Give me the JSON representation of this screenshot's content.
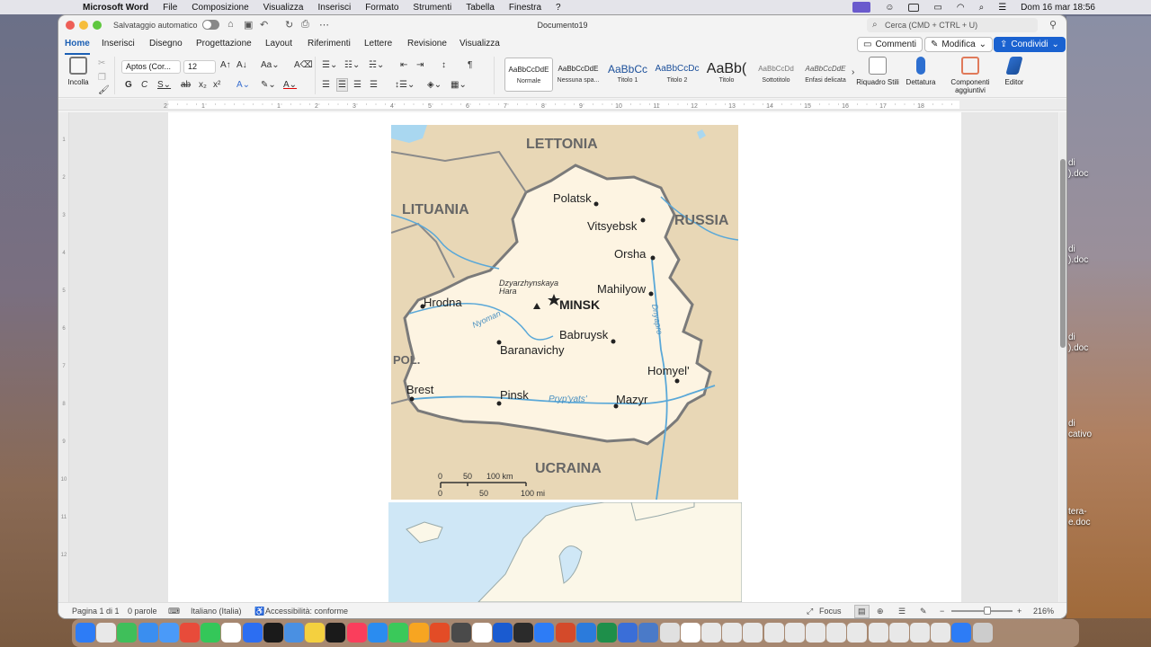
{
  "menubar": {
    "app": "Microsoft Word",
    "items": [
      "File",
      "Composizione",
      "Visualizza",
      "Inserisci",
      "Formato",
      "Strumenti",
      "Tabella",
      "Finestra",
      "?"
    ],
    "datetime": "Dom 16 mar  18:56"
  },
  "desktop_files": [
    "di\n).doc",
    "di\n).doc",
    "di\n).doc",
    "di\ncativo",
    "tera-\ne.doc"
  ],
  "window": {
    "autosave_label": "Salvataggio automatico",
    "doc_title": "Documento19",
    "search_placeholder": "Cerca (CMD + CTRL + U)"
  },
  "tabs": [
    "Home",
    "Inserisci",
    "Disegno",
    "Progettazione",
    "Layout",
    "Riferimenti",
    "Lettere",
    "Revisione",
    "Visualizza"
  ],
  "actions": {
    "comments": "Commenti",
    "edit": "Modifica",
    "share": "Condividi"
  },
  "ribbon": {
    "paste": "Incolla",
    "font": "Aptos (Cor...",
    "size": "12",
    "styles": [
      {
        "preview": "AaBbCcDdE",
        "label": "Normale"
      },
      {
        "preview": "AaBbCcDdE",
        "label": "Nessuna spa..."
      },
      {
        "preview": "AaBbCc",
        "label": "Titolo 1"
      },
      {
        "preview": "AaBbCcDc",
        "label": "Titolo 2"
      },
      {
        "preview": "AaBb(",
        "label": "Titolo"
      },
      {
        "preview": "AaBbCcDd",
        "label": "Sottotitolo"
      },
      {
        "preview": "AaBbCcDdE",
        "label": "Enfasi delicata"
      }
    ],
    "pane": "Riquadro Stili",
    "dictate": "Dettatura",
    "addins": "Componenti aggiuntivi",
    "editor": "Editor"
  },
  "ruler_numbers": [
    "2",
    "1",
    "1",
    "2",
    "3",
    "4",
    "5",
    "6",
    "7",
    "8",
    "9",
    "10",
    "11",
    "12",
    "13",
    "14",
    "15",
    "16",
    "17",
    "18"
  ],
  "vruler_numbers": [
    "1",
    "2",
    "3",
    "4",
    "5",
    "6",
    "7",
    "8",
    "9",
    "10",
    "11",
    "12"
  ],
  "map": {
    "countries": [
      "LETTONIA",
      "LITUANIA",
      "RUSSIA",
      "POL.",
      "UCRAINA"
    ],
    "cities": [
      "Polatsk",
      "Vitsyebsk",
      "Orsha",
      "Mahilyow",
      "Hrodna",
      "Babruysk",
      "Baranavichy",
      "Homyel'",
      "Brest",
      "Pinsk",
      "Mazyr"
    ],
    "capital": "MINSK",
    "peak": "Dzyarzhynskaya\nHara",
    "rivers": [
      "Nyoman",
      "Pryp'yats'",
      "Dnyapro"
    ],
    "scale_km": [
      "0",
      "50",
      "100 km"
    ],
    "scale_mi": [
      "0",
      "50",
      "100 mi"
    ]
  },
  "status": {
    "page": "Pagina 1 di 1",
    "words": "0 parole",
    "language": "Italiano (Italia)",
    "accessibility": "Accessibilità: conforme",
    "focus": "Focus",
    "zoom": "216%"
  },
  "colors": {
    "accent": "#1b5fb4",
    "map_land": "#fdf4e2",
    "map_neighbors": "#e8d7b6",
    "map_water": "#a9d7f0"
  }
}
